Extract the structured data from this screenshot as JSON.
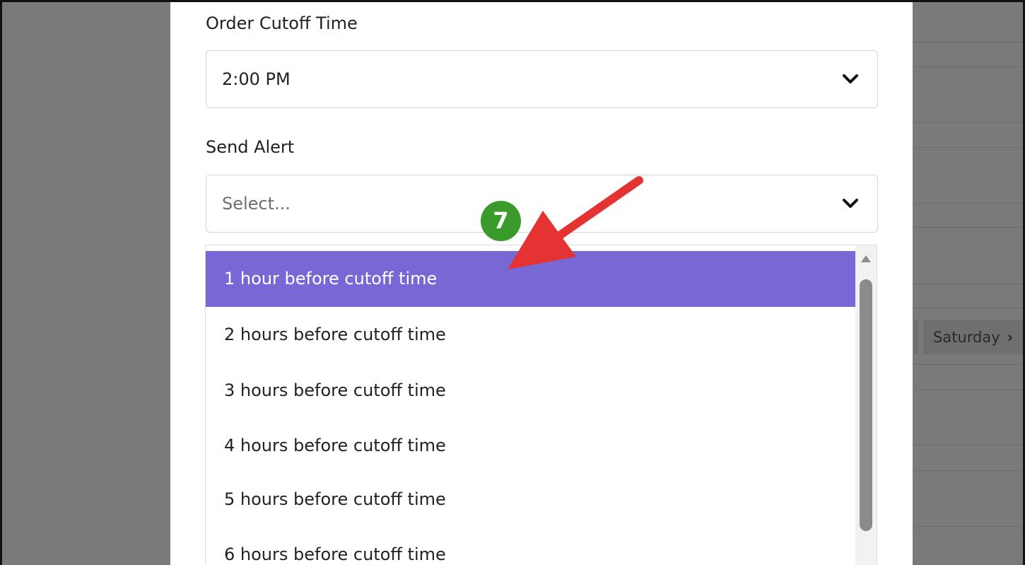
{
  "background": {
    "day_pill_label": "Saturday",
    "day_pill_chevron": "›"
  },
  "form": {
    "cutoff": {
      "label": "Order Cutoff Time",
      "value": "2:00 PM"
    },
    "alert": {
      "label": "Send Alert",
      "placeholder": "Select...",
      "options": [
        "1 hour before cutoff time",
        "2 hours before cutoff time",
        "3 hours before cutoff time",
        "4 hours before cutoff time",
        "5 hours before cutoff time",
        "6 hours before cutoff time"
      ],
      "highlighted_index": 0
    }
  },
  "annotation": {
    "step_number": "7",
    "badge_color": "#3a9a2b",
    "arrow_color": "#e53232"
  },
  "colors": {
    "highlight": "#7768d6",
    "backdrop": "#7a7a7a"
  },
  "icons": {
    "select_chevron": "chevron-down-icon",
    "scroll_up": "triangle-up-icon"
  }
}
